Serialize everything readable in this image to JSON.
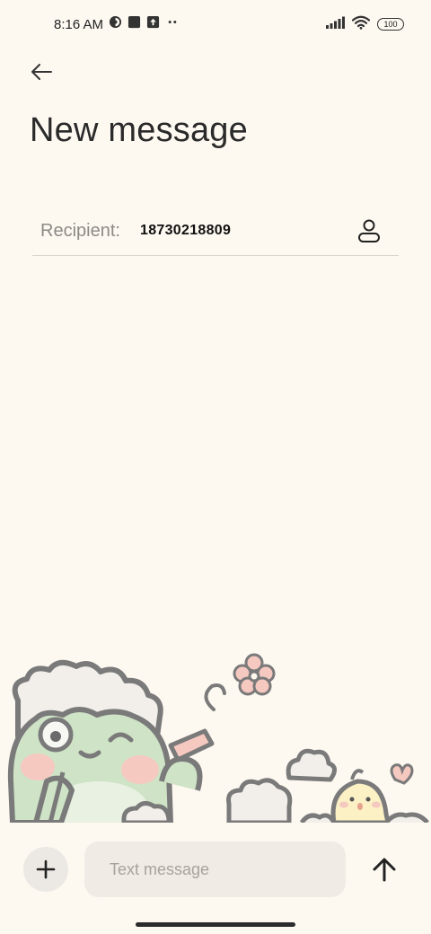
{
  "status_bar": {
    "time": "8:16 AM",
    "battery": "100",
    "icons_left": [
      "vpn-icon",
      "app-square-icon",
      "upload-icon",
      "more-dots-icon"
    ],
    "icons_right": [
      "signal-icon",
      "wifi-icon",
      "battery-icon"
    ]
  },
  "header": {
    "back_icon": "back-arrow-icon",
    "title": "New message"
  },
  "recipient": {
    "label": "Recipient:",
    "value": "18730218809",
    "contact_icon": "person-icon"
  },
  "compose": {
    "attach_icon": "plus-icon",
    "placeholder": "Text message",
    "value": "",
    "send_icon": "send-arrow-icon"
  },
  "wallpaper": {
    "stickers": [
      "frog-sticker",
      "flower-icon",
      "cloud-icon",
      "chick-sticker",
      "heart-icon"
    ]
  },
  "colors": {
    "background": "#fdf8f0",
    "input_background": "#f0ebe4",
    "accent_frog": "#cfe3c6",
    "blush": "#f6c9c0"
  }
}
